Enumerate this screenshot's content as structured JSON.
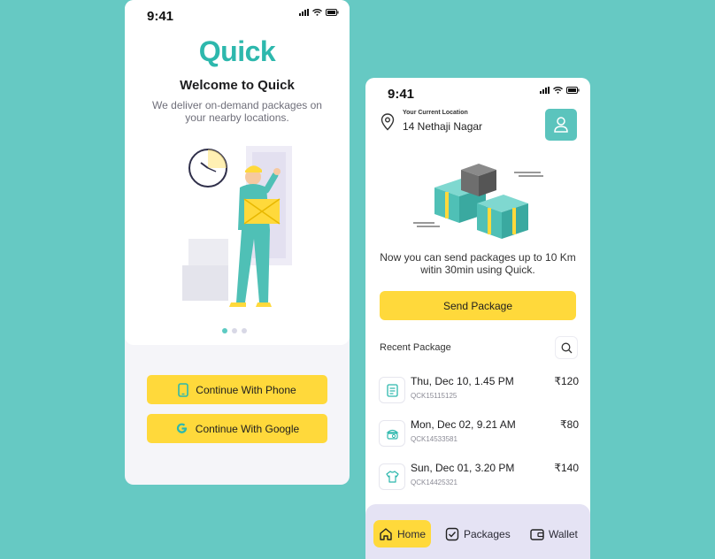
{
  "status": {
    "time": "9:41"
  },
  "onboarding": {
    "logo": "Quick",
    "title": "Welcome to Quick",
    "subtitle": "We deliver on-demand packages on your nearby locations.",
    "phone_button": "Continue With Phone",
    "google_button": "Continue With Google",
    "page_indicator": {
      "count": 3,
      "active": 0
    }
  },
  "home": {
    "location_caption": "Your Current Location",
    "location_value": "14 Nethaji Nagar",
    "message": "Now you can send packages up to 10 Km witin 30min using Quick.",
    "send_button": "Send Package",
    "recent_title": "Recent Package",
    "packages": [
      {
        "date": "Thu, Dec 10, 1.45 PM",
        "code": "QCK15115125",
        "price": "₹120",
        "icon": "document-icon"
      },
      {
        "date": "Mon, Dec 02, 9.21 AM",
        "code": "QCK14533581",
        "price": "₹80",
        "icon": "food-icon"
      },
      {
        "date": "Sun, Dec 01, 3.20 PM",
        "code": "QCK14425321",
        "price": "₹140",
        "icon": "shirt-icon"
      }
    ],
    "tabs": [
      {
        "label": "Home",
        "icon": "home-icon",
        "active": true
      },
      {
        "label": "Packages",
        "icon": "packages-icon",
        "active": false
      },
      {
        "label": "Wallet",
        "icon": "wallet-icon",
        "active": false
      }
    ]
  },
  "colors": {
    "background": "#66c9c3",
    "accent": "#ffd93b",
    "brand": "#2db8ad"
  }
}
